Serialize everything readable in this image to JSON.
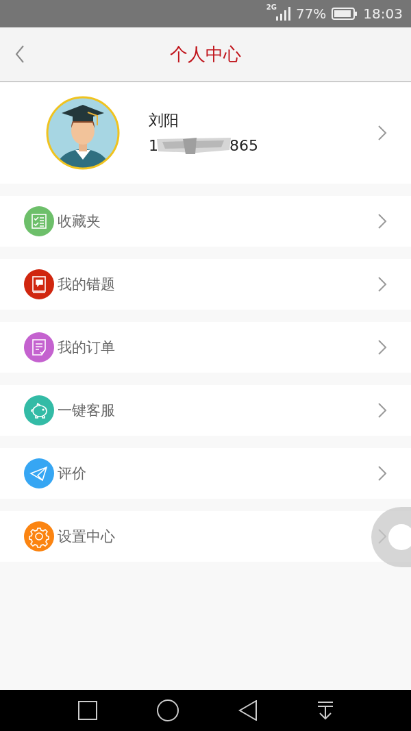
{
  "status_bar": {
    "network": "2G",
    "battery": "77%",
    "time": "18:03"
  },
  "header": {
    "title": "个人中心"
  },
  "profile": {
    "name": "刘阳",
    "phone_start": "1",
    "phone_end": "865"
  },
  "menu": [
    {
      "label": "收藏夹",
      "kind": "checklist",
      "color": "#6dbf6a"
    },
    {
      "label": "我的错题",
      "kind": "book",
      "color": "#d0260f"
    },
    {
      "label": "我的订单",
      "kind": "order",
      "color": "#c462cf"
    },
    {
      "label": "一键客服",
      "kind": "piggy",
      "color": "#33bba6"
    },
    {
      "label": "评价",
      "kind": "plane",
      "color": "#36a6f3"
    },
    {
      "label": "设置中心",
      "kind": "gear",
      "color": "#fb8411"
    }
  ]
}
